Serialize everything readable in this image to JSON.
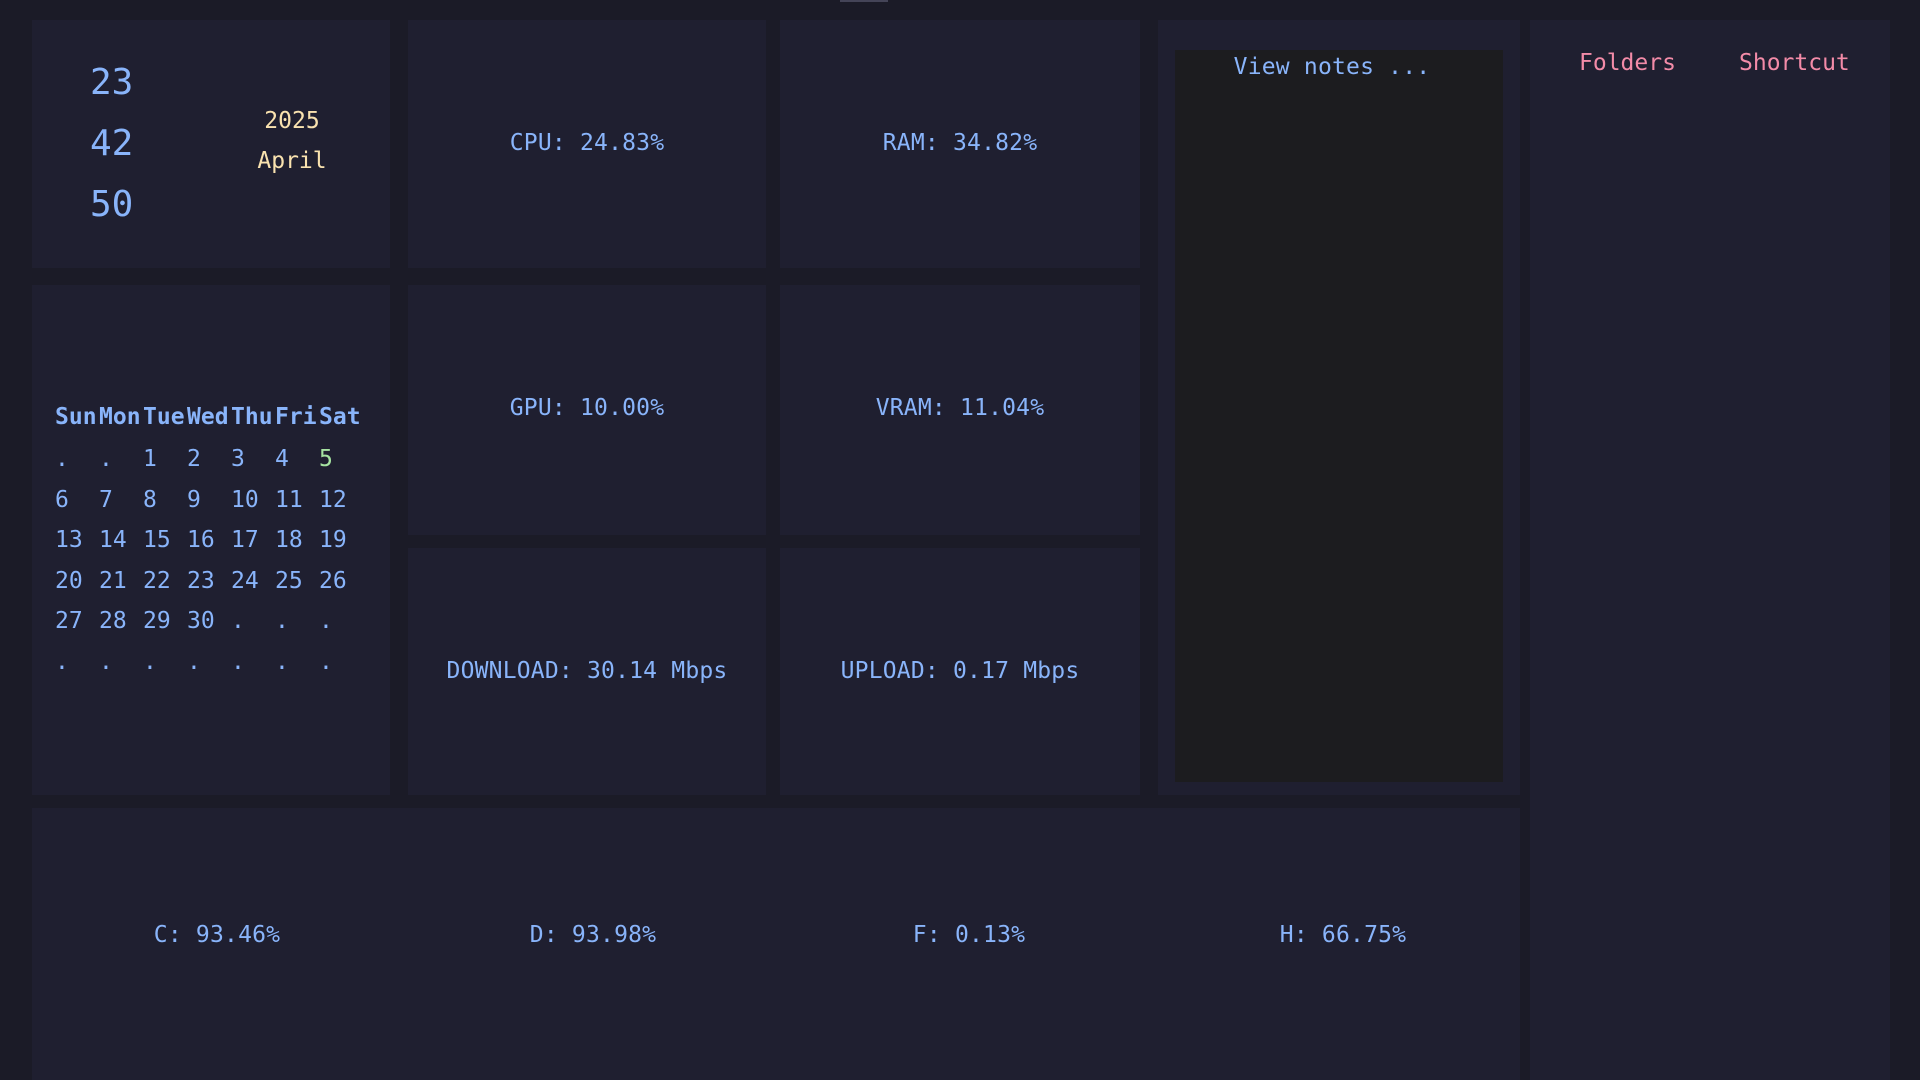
{
  "clock": {
    "hours": "23",
    "minutes": "42",
    "seconds": "50",
    "year": "2025",
    "month": "April"
  },
  "stats": {
    "cpu": "CPU: 24.83%",
    "ram": "RAM: 34.82%",
    "gpu": "GPU: 10.00%",
    "vram": "VRAM: 11.04%",
    "download": "DOWNLOAD: 30.14 Mbps",
    "upload": "UPLOAD: 0.17 Mbps"
  },
  "calendar": {
    "weekdays": [
      "Sun",
      "Mon",
      "Tue",
      "Wed",
      "Thu",
      "Fri",
      "Sat"
    ],
    "today": "5",
    "weeks": [
      [
        ".",
        ".",
        "1",
        "2",
        "3",
        "4",
        "5"
      ],
      [
        "6",
        "7",
        "8",
        "9",
        "10",
        "11",
        "12"
      ],
      [
        "13",
        "14",
        "15",
        "16",
        "17",
        "18",
        "19"
      ],
      [
        "20",
        "21",
        "22",
        "23",
        "24",
        "25",
        "26"
      ],
      [
        "27",
        "28",
        "29",
        "30",
        ".",
        ".",
        "."
      ],
      [
        ".",
        ".",
        ".",
        ".",
        ".",
        ".",
        "."
      ]
    ]
  },
  "notes": {
    "label": "View notes ..."
  },
  "links": {
    "folders": "Folders",
    "shortcut": "Shortcut"
  },
  "drives": {
    "c": "C: 93.46%",
    "d": "D: 93.98%",
    "f": "F: 0.13%",
    "h": "H: 66.75%"
  },
  "colors": {
    "background": "#1b1b27",
    "panel": "#1f1f30",
    "accent_blue": "#89b4fa",
    "accent_yellow": "#f9e2af",
    "accent_green": "#a6e3a1",
    "accent_pink": "#f38ba8"
  }
}
